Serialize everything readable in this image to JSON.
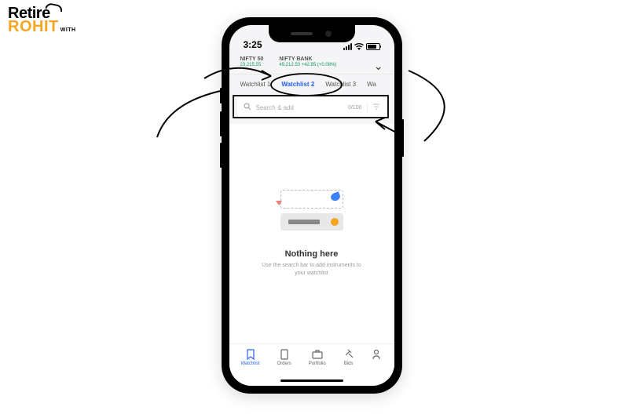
{
  "logo": {
    "line1": "Retire",
    "line2": "ROHIT",
    "tag": "WITH"
  },
  "statusBar": {
    "time": "3:25"
  },
  "indices": [
    {
      "name": "NIFTY 50",
      "value": "23,215.55"
    },
    {
      "name": "NIFTY BANK",
      "value": "49,212.50 +42.85 (+0.08%)"
    }
  ],
  "tabs": [
    {
      "label": "Watchlist 1",
      "active": false
    },
    {
      "label": "Watchlist 2",
      "active": true
    },
    {
      "label": "Watchlist 3",
      "active": false
    },
    {
      "label": "Wa",
      "active": false
    }
  ],
  "search": {
    "placeholder": "Search & add",
    "count": "0/100"
  },
  "emptyState": {
    "title": "Nothing here",
    "subtitle": "Use the search bar to add instruments to your watchlist"
  },
  "bottomNav": [
    {
      "label": "Watchlist",
      "active": true
    },
    {
      "label": "Orders",
      "active": false
    },
    {
      "label": "Portfolio",
      "active": false
    },
    {
      "label": "Bids",
      "active": false
    },
    {
      "label": "",
      "active": false
    }
  ]
}
